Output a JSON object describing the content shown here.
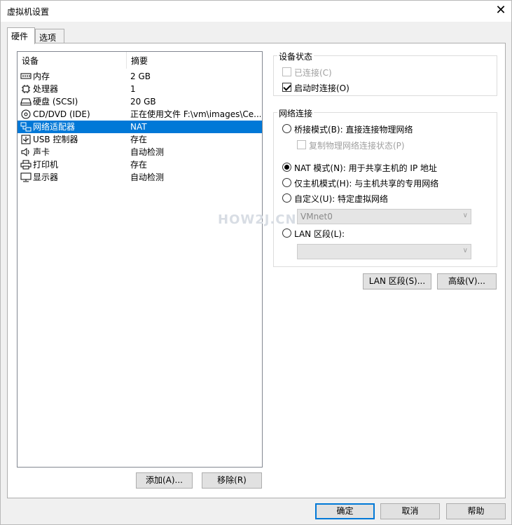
{
  "window": {
    "title": "虚拟机设置",
    "close_symbol": "✕"
  },
  "tabs": [
    {
      "label": "硬件"
    },
    {
      "label": "选项"
    }
  ],
  "device_list": {
    "columns": [
      "设备",
      "摘要"
    ],
    "rows": [
      {
        "name": "内存",
        "summary": "2 GB",
        "icon": "memory-icon"
      },
      {
        "name": "处理器",
        "summary": "1",
        "icon": "processor-icon"
      },
      {
        "name": "硬盘 (SCSI)",
        "summary": "20 GB",
        "icon": "hard-disk-icon"
      },
      {
        "name": "CD/DVD (IDE)",
        "summary": "正在使用文件 F:\\vm\\images\\Ce...",
        "icon": "cd-dvd-icon"
      },
      {
        "name": "网络适配器",
        "summary": "NAT",
        "icon": "network-adapter-icon",
        "selected": true
      },
      {
        "name": "USB 控制器",
        "summary": "存在",
        "icon": "usb-controller-icon"
      },
      {
        "name": "声卡",
        "summary": "自动检测",
        "icon": "sound-card-icon"
      },
      {
        "name": "打印机",
        "summary": "存在",
        "icon": "printer-icon"
      },
      {
        "name": "显示器",
        "summary": "自动检测",
        "icon": "display-icon"
      }
    ]
  },
  "device_buttons": {
    "add": "添加(A)...",
    "remove": "移除(R)"
  },
  "device_status": {
    "title": "设备状态",
    "connected": {
      "label": "已连接(C)",
      "checked": false,
      "enabled": false
    },
    "connect_at_power_on": {
      "label": "启动时连接(O)",
      "checked": true
    }
  },
  "network_connection": {
    "title": "网络连接",
    "bridged": {
      "label": "桥接模式(B): 直接连接物理网络",
      "checked": false
    },
    "replicate_state": {
      "label": "复制物理网络连接状态(P)",
      "checked": false,
      "enabled": false
    },
    "nat": {
      "label": "NAT 模式(N): 用于共享主机的 IP 地址",
      "checked": true
    },
    "host_only": {
      "label": "仅主机模式(H): 与主机共享的专用网络",
      "checked": false
    },
    "custom": {
      "label": "自定义(U): 特定虚拟网络",
      "checked": false
    },
    "custom_select_value": "VMnet0",
    "lan_segment": {
      "label": "LAN 区段(L):",
      "checked": false
    },
    "lan_select_value": ""
  },
  "adapter_buttons": {
    "lan_segments": "LAN 区段(S)...",
    "advanced": "高级(V)..."
  },
  "watermark": "HOW2J.CN",
  "footer": {
    "ok": "确定",
    "cancel": "取消",
    "help": "帮助"
  },
  "colors": {
    "selection": "#0078d7",
    "window_bg": "#f0f0f0",
    "panel_bg": "#ffffff"
  }
}
